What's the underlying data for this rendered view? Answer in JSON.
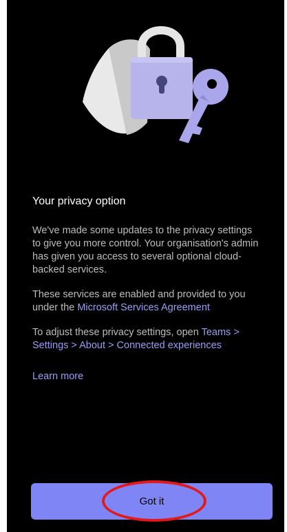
{
  "header": {
    "title": "Your privacy option"
  },
  "body": {
    "paragraph1": "We've made some updates to the privacy settings to give you more control. Your organisation's admin has given you access to several optional cloud-backed services.",
    "paragraph2_prefix": "These services are enabled and provided to you under the ",
    "paragraph2_link": "Microsoft Services Agreement",
    "paragraph3_prefix": "To adjust these privacy settings, open ",
    "paragraph3_link": "Teams > Settings > About > Connected experiences",
    "learn_more": "Learn more"
  },
  "footer": {
    "button_label": "Got it"
  },
  "illustration": {
    "icons": [
      "shield-icon",
      "padlock-icon",
      "key-icon"
    ]
  },
  "colors": {
    "background": "#000000",
    "accent": "#7f85f5",
    "link": "#9a9ef2",
    "highlight_ring": "#e1191b"
  }
}
